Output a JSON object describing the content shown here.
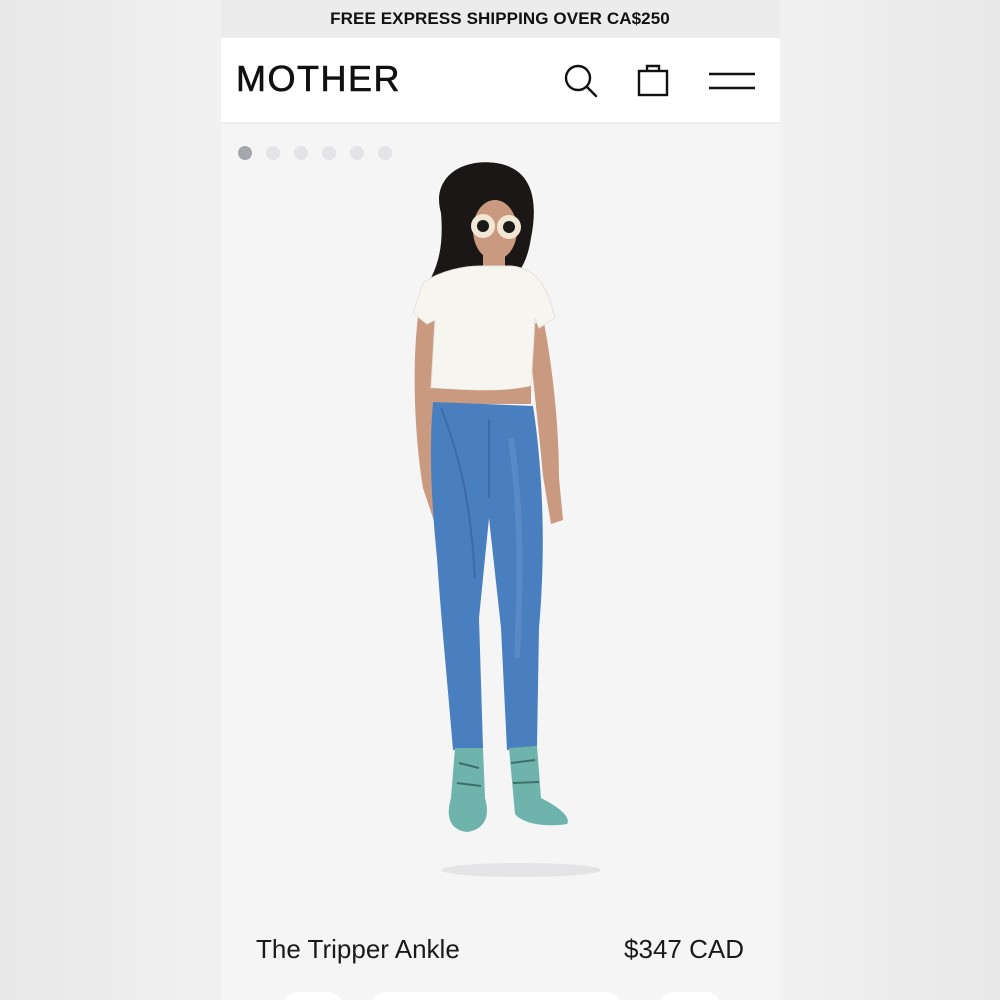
{
  "promo_banner": {
    "text": "FREE EXPRESS SHIPPING OVER CA$250"
  },
  "header": {
    "logo": "MOTHER",
    "icons": {
      "search": "search-icon",
      "bag": "shopping-bag-icon",
      "menu": "hamburger-menu-icon"
    }
  },
  "carousel": {
    "total": 6,
    "active_index": 0
  },
  "product": {
    "name": "The Tripper Ankle",
    "price": "$347 CAD"
  },
  "colors": {
    "page_background": "#ececec",
    "header_background": "#ffffff",
    "content_background": "#f5f5f6",
    "text": "#111111",
    "dot_active": "#a6a6ad",
    "dot_inactive": "#e3e3e8",
    "denim": "#4a7fbf",
    "boots": "#6fb3ad"
  }
}
